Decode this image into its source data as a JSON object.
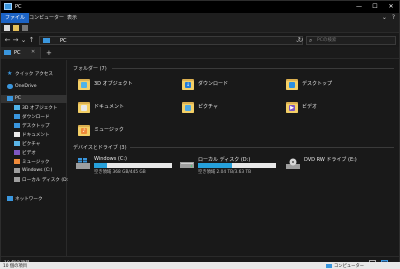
{
  "window": {
    "title": "PC"
  },
  "window_controls": {
    "minimize": "—",
    "maximize": "☐",
    "close": "✕"
  },
  "ribbon": {
    "tabs": [
      "ファイル",
      "コンピューター",
      "表示"
    ],
    "expand": "⌄",
    "help": "?"
  },
  "address": {
    "path": "PC",
    "back": "←",
    "forward": "→",
    "recent": "⌄",
    "up": "↑",
    "dropdown": "⌄",
    "refresh": "↻"
  },
  "search": {
    "placeholder": "PCの検索",
    "icon": "⌕"
  },
  "doc_tab": {
    "label": "PC",
    "close": "✕",
    "new_tab": "+"
  },
  "sidebar": {
    "items": [
      {
        "label": "クイック アクセス",
        "icon": "star-icon",
        "color": "#3a96dd"
      },
      {
        "label": "OneDrive",
        "icon": "cloud-icon",
        "color": "#3a96dd"
      },
      {
        "label": "PC",
        "icon": "pc-icon",
        "color": "#3a96dd"
      },
      {
        "label": "3D オブジェクト",
        "icon": "cube-icon",
        "color": "#4fb3e8"
      },
      {
        "label": "ダウンロード",
        "icon": "download-icon",
        "color": "#3a96dd"
      },
      {
        "label": "デスクトップ",
        "icon": "desktop-icon",
        "color": "#3a96dd"
      },
      {
        "label": "ドキュメント",
        "icon": "document-icon",
        "color": "#e8e8e8"
      },
      {
        "label": "ピクチャ",
        "icon": "picture-icon",
        "color": "#5ab4e6"
      },
      {
        "label": "ビデオ",
        "icon": "video-icon",
        "color": "#7e57c2"
      },
      {
        "label": "ミュージック",
        "icon": "music-icon",
        "color": "#ef8a3a"
      },
      {
        "label": "Windows (C:)",
        "icon": "drive-icon",
        "color": "#9e9e9e"
      },
      {
        "label": "ローカル ディスク (D:)",
        "icon": "drive-icon",
        "color": "#9e9e9e"
      },
      {
        "label": "ネットワーク",
        "icon": "network-icon",
        "color": "#3a96dd"
      }
    ]
  },
  "content": {
    "folders_header": "フォルダー (7)",
    "folders": [
      {
        "label": "3D オブジェクト",
        "icon": "cube-folder-icon",
        "accent": "#4fb3e8"
      },
      {
        "label": "ダウンロード",
        "icon": "download-folder-icon",
        "accent": "#1f7ad8"
      },
      {
        "label": "デスクトップ",
        "icon": "desktop-folder-icon",
        "accent": "#2a8ee0"
      },
      {
        "label": "ドキュメント",
        "icon": "document-folder-icon",
        "accent": "#e8e8e8"
      },
      {
        "label": "ピクチャ",
        "icon": "picture-folder-icon",
        "accent": "#4fa8e0"
      },
      {
        "label": "ビデオ",
        "icon": "video-folder-icon",
        "accent": "#7e57c2"
      },
      {
        "label": "ミュージック",
        "icon": "music-folder-icon",
        "accent": "#ef8a3a"
      }
    ],
    "drives_header": "デバイスとドライブ (3)",
    "drives": [
      {
        "name": "Windows (C:)",
        "free": "空き領域 368 GB/445 GB",
        "used_fraction": 0.17,
        "icon": "windows-drive-icon"
      },
      {
        "name": "ローカル ディスク (D:)",
        "free": "空き領域 2.04 TB/3.63 TB",
        "used_fraction": 0.44,
        "icon": "hard-drive-icon"
      },
      {
        "name": "DVD RW ドライブ (E:)",
        "free": "",
        "used_fraction": null,
        "icon": "dvd-drive-icon"
      }
    ]
  },
  "status": {
    "count": "10 個の項目"
  },
  "footer": {
    "count": "10 個の項目",
    "location": "コンピューター"
  },
  "colors": {
    "accent": "#1c63c4",
    "folder": "#f3cf66",
    "drive_bar": "#26a0da",
    "background": "#191919"
  }
}
